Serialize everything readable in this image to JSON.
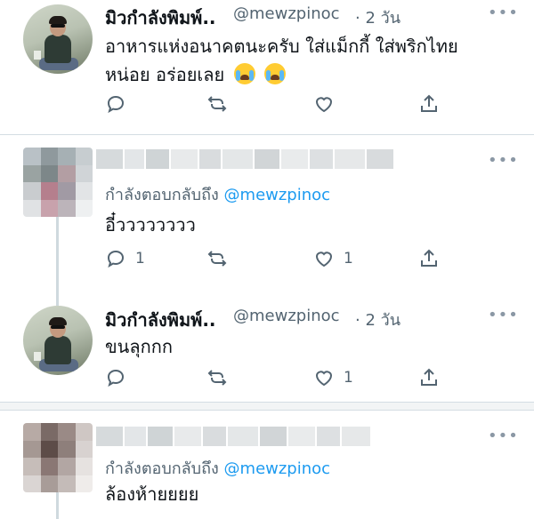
{
  "tweets": [
    {
      "name": "มิวกำลังพิมพ์..",
      "handle": "@mewzpinoc",
      "time": "· 2 วัน",
      "text_line1": "อาหารแห่งอนาคตนะครับ ใส่แม็กกี้ ใส่พริกไทย",
      "text_line2": "หน่อย อร่อยเลย",
      "emoji": [
        "loudly-crying-face",
        "loudly-crying-face"
      ],
      "reply_count": "",
      "like_count": ""
    },
    {
      "reply_prefix": "กำลังตอบกลับถึง",
      "reply_handle": "@mewzpinoc",
      "text": "อี๋วววววววว",
      "reply_count": "1",
      "like_count": "1"
    },
    {
      "name": "มิวกำลังพิมพ์..",
      "handle": "@mewzpinoc",
      "time": "· 2 วัน",
      "text": "ขนลุกกก",
      "reply_count": "",
      "like_count": "1"
    },
    {
      "reply_prefix": "กำลังตอบกลับถึง",
      "reply_handle": "@mewzpinoc",
      "text": "ล้องห้ายยยย"
    }
  ],
  "more_label": "•••",
  "icons": {
    "reply": "reply-icon",
    "retweet": "retweet-icon",
    "like": "heart-icon",
    "share": "share-icon",
    "more": "more-icon"
  },
  "colors": {
    "link": "#1d9bf0",
    "secondary": "#536471",
    "divider": "#d4dde3"
  }
}
